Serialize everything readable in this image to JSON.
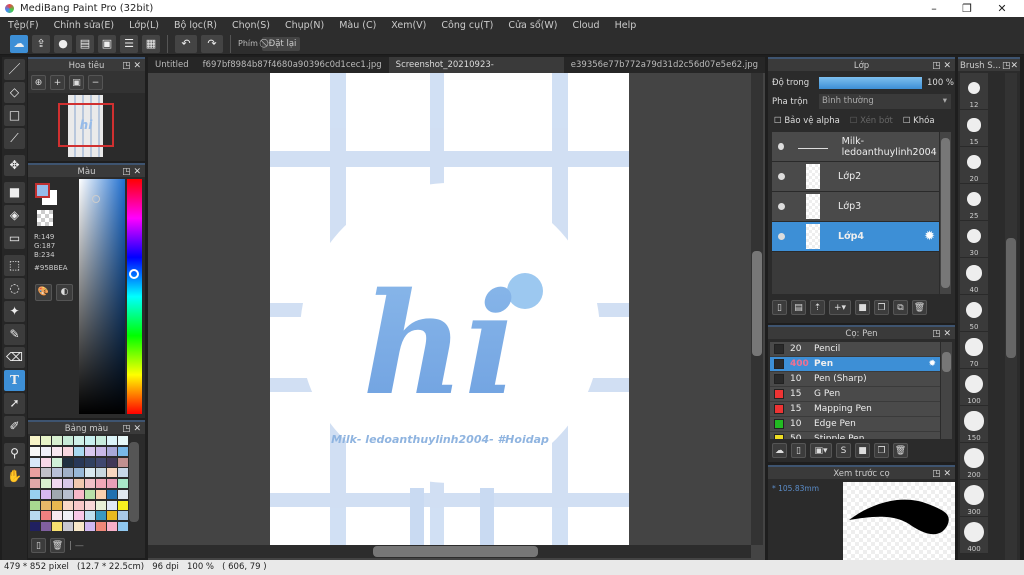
{
  "title": "MediBang Paint Pro (32bit)",
  "menu": [
    "Tệp(F)",
    "Chỉnh sửa(E)",
    "Lớp(L)",
    "Bộ lọc(R)",
    "Chọn(S)",
    "Chụp(N)",
    "Màu (C)",
    "Xem(V)",
    "Công cụ(T)",
    "Cửa sổ(W)",
    "Cloud",
    "Help"
  ],
  "toolbar": {
    "keys_label": "Phím",
    "reset_label": "Đặt lại"
  },
  "tabs": [
    "Untitled",
    "f697bf8984b87f4680a90396c0d1cec1.jpg",
    "Screenshot_20210923-200251_Gallery.jpg",
    "e39356e77b772a79d31d2c56d07e5e62.jpg"
  ],
  "active_tab": 2,
  "navigator": {
    "title": "Hoa tiêu"
  },
  "color": {
    "title": "Màu",
    "r": "R:149",
    "g": "G:187",
    "b": "B:234",
    "hex": "#95BBEA",
    "current": "#95bbea"
  },
  "palette": {
    "title": "Bảng màu",
    "colors": [
      "#f8f4c8",
      "#e8f4c8",
      "#d8f0d0",
      "#c8ecd8",
      "#d0f0e8",
      "#c8f0f0",
      "#c8ecdc",
      "#dcf4f8",
      "#e8f8f8",
      "#f8f8f8",
      "#f0f0f8",
      "#f8e8f0",
      "#f8d8e0",
      "#a8d8f0",
      "#d8c8f0",
      "#c8b8e8",
      "#a8a8d8",
      "#78b8e8",
      "#d8e8f8",
      "#f8d8e8",
      "#d0f0d8",
      "#203040",
      "#283858",
      "#304060",
      "#404870",
      "#403858",
      "#c09090",
      "#e8a0a0",
      "#c0c0c8",
      "#b8c0d8",
      "#a0b0c8",
      "#98b8d8",
      "#d8e8f0",
      "#c8d8e0",
      "#f8d8c0",
      "#c8d8e8",
      "#e0a8a8",
      "#d8f0d0",
      "#f0d8f0",
      "#d8c8e8",
      "#f0c8b0",
      "#f0c0c8",
      "#f0a8b8",
      "#e8a0b8",
      "#a8e8c8",
      "#98d0f0",
      "#d8b8f0",
      "#a0a8b0",
      "#b8c0d0",
      "#f8b8c8",
      "#b8e0a8",
      "#f8d0b0",
      "#2070b0",
      "#e0e8f0",
      "#a8d890",
      "#e8b868",
      "#e8b850",
      "#f8d8c8",
      "#f8c8c8",
      "#f8d8d8",
      "#e8f0d8",
      "#e0e8f8",
      "#f8f020",
      "#b8d8f0",
      "#f08080",
      "#f8e8f0",
      "#f0f0f8",
      "#f8c8e8",
      "#c0e0f0",
      "#3898c0",
      "#e8b820",
      "#a8c8e8",
      "#202060",
      "#8060a0",
      "#f8e070",
      "#c8c8d0",
      "#f8e8c8",
      "#d0b8f0",
      "#f08878",
      "#f8b0c8",
      "#90c8f0"
    ]
  },
  "layers": {
    "title": "Lớp",
    "opacity_label": "Độ trong",
    "opacity_value": "100 %",
    "opacity": 1.0,
    "blend_label": "Pha trộn",
    "blend_value": "Bình thường",
    "protect_alpha": "Bảo vệ alpha",
    "clip": "Xén bớt",
    "lock": "Khóa",
    "items": [
      {
        "name": "Milk- ledoanthuylinh2004"
      },
      {
        "name": "Lớp2"
      },
      {
        "name": "Lớp3"
      },
      {
        "name": "Lớp4",
        "selected": true
      }
    ]
  },
  "brush": {
    "title": "Cọ: Pen",
    "items": [
      {
        "size": "20",
        "name": "Pencil",
        "color": "#2a2a2a"
      },
      {
        "size": "400",
        "name": "Pen",
        "color": "#2a2a2a",
        "selected": true
      },
      {
        "size": "10",
        "name": "Pen (Sharp)",
        "color": "#2a2a2a"
      },
      {
        "size": "15",
        "name": "G Pen",
        "color": "#ee3333"
      },
      {
        "size": "15",
        "name": "Mapping Pen",
        "color": "#ee3333"
      },
      {
        "size": "10",
        "name": "Edge Pen",
        "color": "#22bb22"
      },
      {
        "size": "50",
        "name": "Stipple Pen",
        "color": "#eedd22"
      }
    ]
  },
  "preview": {
    "title": "Xem trước cọ",
    "size": "105.83mm"
  },
  "brush_sizes": {
    "title": "Brush S...",
    "sizes": [
      "12",
      "15",
      "20",
      "25",
      "30",
      "40",
      "50",
      "70",
      "100",
      "150",
      "200",
      "300",
      "400"
    ]
  },
  "canvas": {
    "caption": "Milk- ledoanthuylinh2004- #Hoidap",
    "art_text": "hi"
  },
  "status": {
    "text": "479 * 852 pixel   (12.7 * 22.5cm)   96 dpi   100 %   ( 606, 79 )"
  }
}
